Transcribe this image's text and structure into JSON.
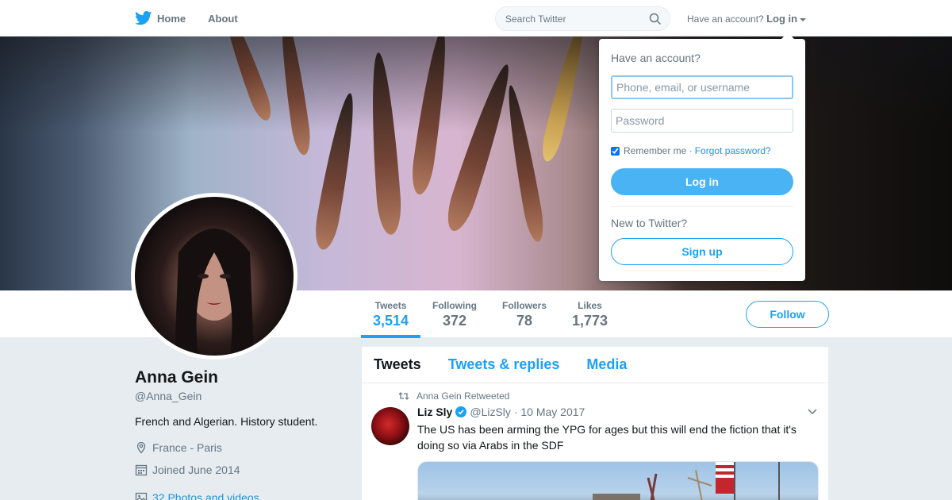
{
  "nav": {
    "home_label": "Home",
    "about_label": "About",
    "search_placeholder": "Search Twitter",
    "have_account": "Have an account?",
    "login_label": "Log in"
  },
  "profile": {
    "name": "Anna Gein",
    "handle": "@Anna_Gein",
    "bio": "French and Algerian. History student.",
    "location": "France - Paris",
    "joined": "Joined June 2014",
    "photos": "32 Photos and videos",
    "follow_label": "Follow"
  },
  "stats": [
    {
      "label": "Tweets",
      "value": "3,514"
    },
    {
      "label": "Following",
      "value": "372"
    },
    {
      "label": "Followers",
      "value": "78"
    },
    {
      "label": "Likes",
      "value": "1,773"
    }
  ],
  "timeline": {
    "tabs": [
      "Tweets",
      "Tweets & replies",
      "Media"
    ],
    "active_tab": "Tweets",
    "tweet": {
      "retweet_note": "Anna Gein Retweeted",
      "author": "Liz Sly",
      "handle": "@LizSly",
      "date": "· 10 May 2017",
      "text": "The US has been arming the YPG for ages but this will end the fiction that it's doing so via Arabs in the SDF"
    }
  },
  "login_dropdown": {
    "title": "Have an account?",
    "username_placeholder": "Phone, email, or username",
    "password_placeholder": "Password",
    "remember_label": "Remember me ·",
    "forgot_label": "Forgot password?",
    "login_button": "Log in",
    "new_prompt": "New to Twitter?",
    "signup_button": "Sign up"
  },
  "colors": {
    "brand_blue": "#1da1f2",
    "text_gray": "#657786",
    "background": "#e6ecf0"
  },
  "icons": [
    "twitter-bird-icon",
    "search-icon",
    "caret-down-icon",
    "location-icon",
    "calendar-icon",
    "photo-icon",
    "retweet-icon",
    "verified-icon",
    "chevron-down-icon"
  ]
}
